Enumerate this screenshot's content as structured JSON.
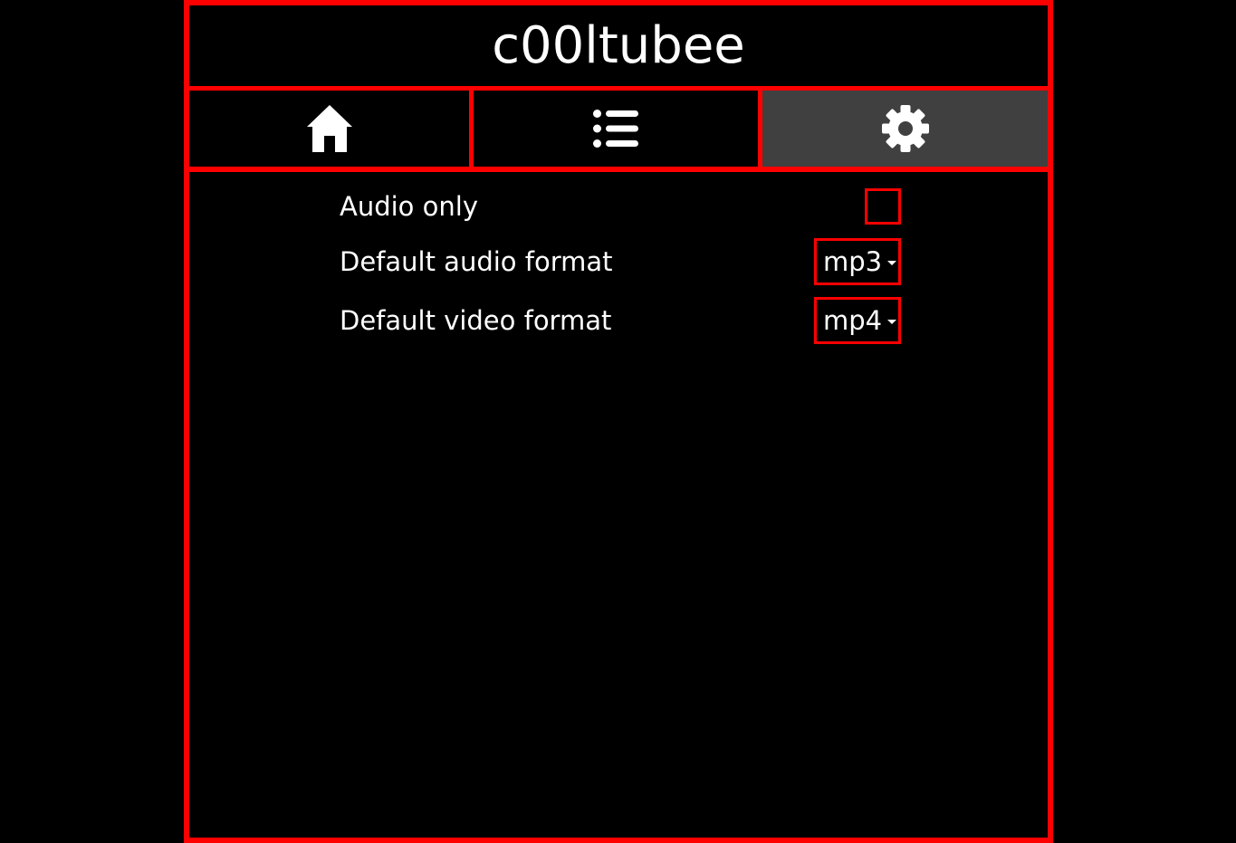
{
  "app": {
    "title": "c00ltubee"
  },
  "tabs": [
    {
      "id": "home",
      "icon": "home-icon",
      "active": false
    },
    {
      "id": "list",
      "icon": "list-icon",
      "active": false
    },
    {
      "id": "settings",
      "icon": "gear-icon",
      "active": true
    }
  ],
  "settings": {
    "audio_only": {
      "label": "Audio only",
      "checked": false
    },
    "audio_format": {
      "label": "Default audio format",
      "value": "mp3"
    },
    "video_format": {
      "label": "Default video format",
      "value": "mp4"
    }
  },
  "colors": {
    "accent": "#ff0000",
    "background": "#000000",
    "active_tab": "#404040",
    "text": "#ffffff"
  }
}
